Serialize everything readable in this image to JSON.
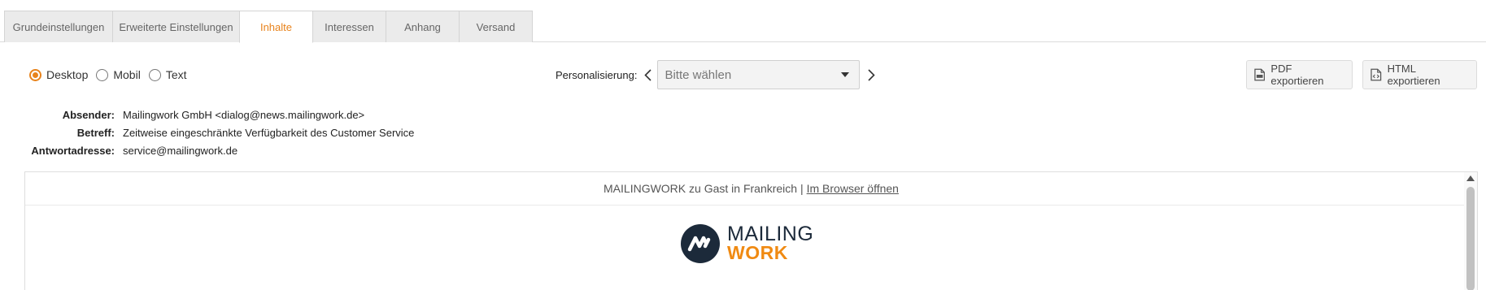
{
  "tabs": [
    {
      "label": "Grundeinstellungen",
      "active": false
    },
    {
      "label": "Erweiterte Einstellungen",
      "active": false
    },
    {
      "label": "Inhalte",
      "active": true
    },
    {
      "label": "Interessen",
      "active": false
    },
    {
      "label": "Anhang",
      "active": false
    },
    {
      "label": "Versand",
      "active": false
    }
  ],
  "view_modes": {
    "selected": "Desktop",
    "options": [
      "Desktop",
      "Mobil",
      "Text"
    ]
  },
  "personalisierung": {
    "label": "Personalisierung:",
    "select_value": "Bitte wählen"
  },
  "export": {
    "pdf_label": "PDF exportieren",
    "html_label": "HTML exportieren"
  },
  "meta": {
    "sender_label": "Absender:",
    "sender_value": "Mailingwork GmbH <dialog@news.mailingwork.de>",
    "subject_label": "Betreff:",
    "subject_value": "Zeitweise eingeschränkte Verfügbarkeit des Customer Service",
    "reply_label": "Antwortadresse:",
    "reply_value": "service@mailingwork.de"
  },
  "preview": {
    "header_text": "MAILINGWORK zu Gast in Frankreich |",
    "browser_link": "Im Browser öffnen",
    "logo_line1": "MAILING",
    "logo_line2": "WORK"
  },
  "colors": {
    "accent": "#e8831c",
    "logo_dark": "#1c2a3a",
    "logo_orange": "#f08a12"
  },
  "icons": [
    "pdf-file-icon",
    "html-file-icon",
    "chevron-left-icon",
    "chevron-right-icon",
    "caret-down-icon",
    "scroll-up-arrow-icon"
  ]
}
